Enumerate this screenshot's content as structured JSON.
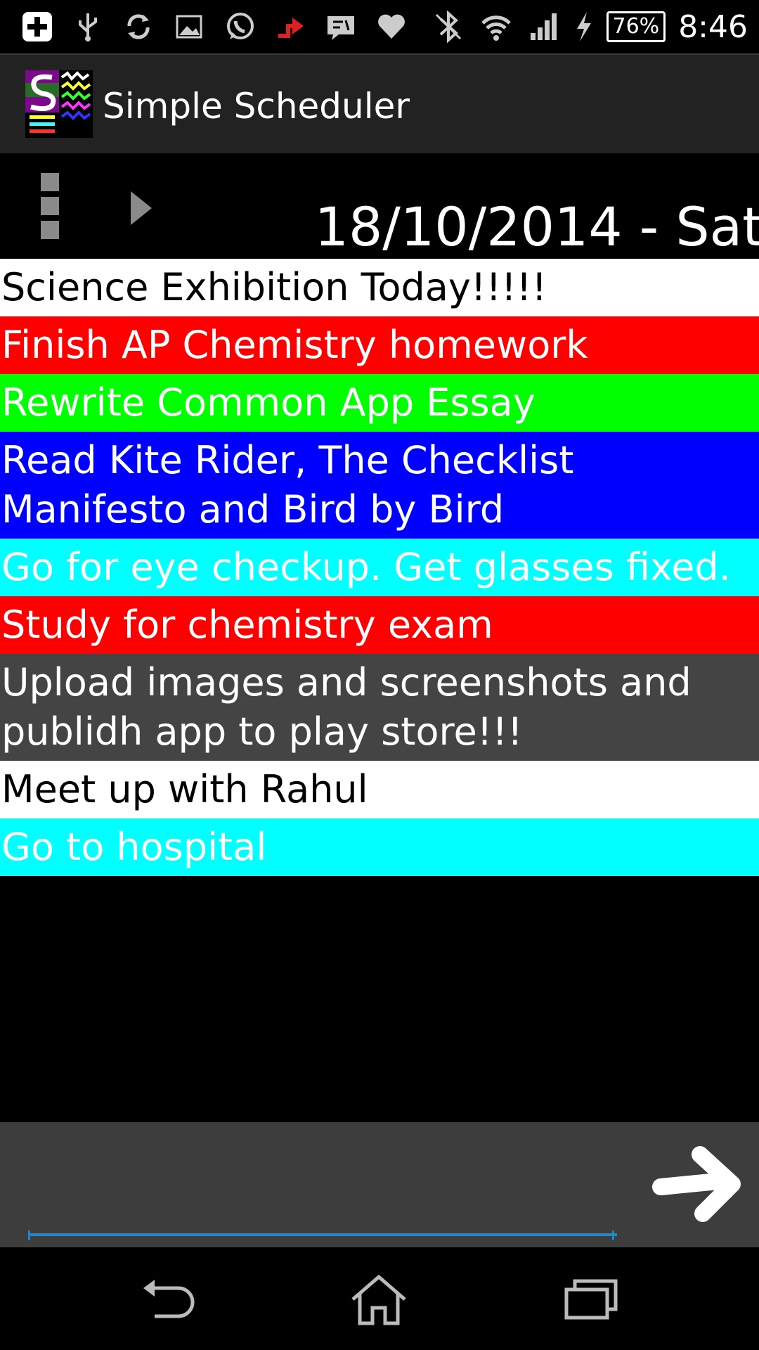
{
  "status_bar": {
    "battery": "76%",
    "time": "8:46"
  },
  "app": {
    "title": "Simple Scheduler"
  },
  "date_bar": {
    "date": "18/10/2014 - Sat"
  },
  "tasks": [
    {
      "text": "Science Exhibition Today!!!!!",
      "bg": "#ffffff",
      "fg": "#000000"
    },
    {
      "text": "Finish AP Chemistry homework",
      "bg": "#ff0000",
      "fg": "#ffffff"
    },
    {
      "text": "Rewrite Common App Essay",
      "bg": "#00ff00",
      "fg": "#ffffff"
    },
    {
      "text": "Read Kite Rider, The Checklist Manifesto and Bird by Bird",
      "bg": "#0000ff",
      "fg": "#ffffff"
    },
    {
      "text": "Go for eye checkup. Get glasses fixed.",
      "bg": "#00ffff",
      "fg": "#ffffff"
    },
    {
      "text": "Study for chemistry exam",
      "bg": "#ff0000",
      "fg": "#ffffff"
    },
    {
      "text": "Upload images and screenshots and publidh app to play store!!!",
      "bg": "#444444",
      "fg": "#ffffff"
    },
    {
      "text": "Meet up with Rahul",
      "bg": "#ffffff",
      "fg": "#000000"
    },
    {
      "text": "Go to hospital",
      "bg": "#00ffff",
      "fg": "#ffffff"
    }
  ],
  "input": {
    "value": "",
    "placeholder": ""
  },
  "icons": {
    "status_left": [
      "plus-notification-icon",
      "usb-icon",
      "sync-icon",
      "image-icon",
      "whatsapp-icon",
      "upload-icon",
      "message-icon",
      "heart-icon"
    ],
    "status_right": [
      "bluetooth-off-icon",
      "wifi-icon",
      "signal-icon",
      "charging-icon"
    ],
    "send": "arrow-right-icon",
    "nav": [
      "back-icon",
      "home-icon",
      "recent-apps-icon"
    ]
  },
  "colors": {
    "input_underline": "#1e88c8",
    "action_bar": "#222222",
    "input_bar": "#3d3d3d"
  }
}
